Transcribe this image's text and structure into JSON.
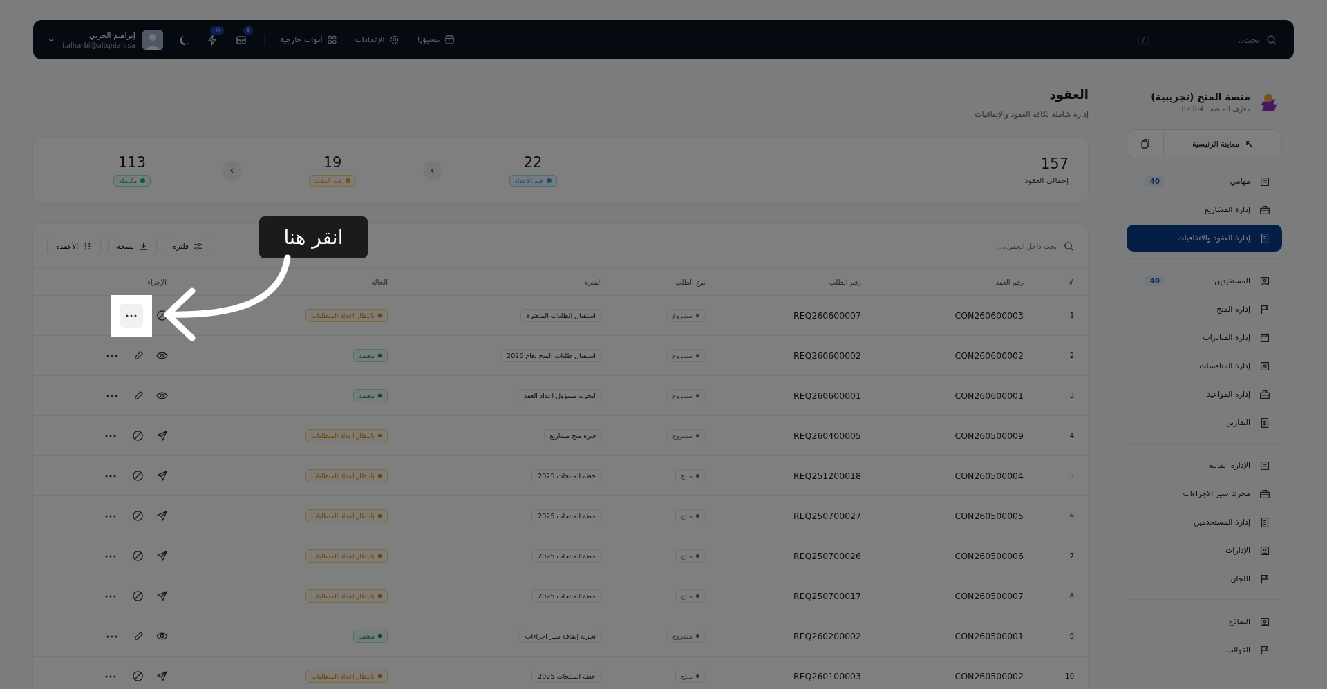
{
  "topbar": {
    "search": {
      "placeholder": "بحث..",
      "shortcut": "/"
    },
    "links": [
      {
        "label": "تنسيق!"
      },
      {
        "label": "الإعدادات"
      },
      {
        "label": "أدوات خارجية"
      }
    ],
    "notifications": [
      {
        "count": "1"
      },
      {
        "count": "39"
      }
    ],
    "user": {
      "name": "إبراهيم الحربي",
      "email": "i.alharbi@altqniah.sa"
    }
  },
  "sidebar": {
    "platform": {
      "name": "منصة المنح (تجريبية)",
      "id_line": "معرّف المنصة : 82384"
    },
    "preview": {
      "label": "معاينة الرئيسية"
    },
    "groups": [
      [
        {
          "label": "مهامي",
          "badge": "40",
          "selected": false
        },
        {
          "label": "إدارة المشاريع",
          "selected": false
        },
        {
          "label": "إدارة العقود والاتفاقيات",
          "selected": true
        }
      ],
      [
        {
          "label": "المستفيدين",
          "badge": "40",
          "selected": false
        },
        {
          "label": "إدارة المنح",
          "selected": false
        },
        {
          "label": "إدارة المبادرات",
          "selected": false
        },
        {
          "label": "إدارة المنافسات",
          "selected": false
        },
        {
          "label": "إدارة المواعيد",
          "selected": false
        },
        {
          "label": "التقارير",
          "selected": false
        }
      ],
      [
        {
          "label": "الإدارة المالية",
          "selected": false
        },
        {
          "label": "محرك سير الاجراءات",
          "selected": false
        },
        {
          "label": "إدارة المستخدمين",
          "selected": false
        },
        {
          "label": "الإدارات",
          "selected": false
        },
        {
          "label": "اللجان",
          "selected": false
        }
      ],
      [
        {
          "label": "النماذج",
          "selected": false
        },
        {
          "label": "القوالب",
          "selected": false
        }
      ]
    ]
  },
  "header": {
    "title": "العقود",
    "subtitle": "إدارة شاملة لكافة العقود والإتفاقيات"
  },
  "stats": {
    "total": {
      "value": "157",
      "label": "إجمالي العقود"
    },
    "items": [
      {
        "value": "22",
        "label": "قيد الاعداد",
        "kind": "preparing"
      },
      {
        "value": "19",
        "label": "قيد التنفيذ",
        "kind": "executing"
      },
      {
        "value": "113",
        "label": "مكتملة",
        "kind": "completed"
      }
    ]
  },
  "table": {
    "search": {
      "placeholder": "بحث داخل الحقول..."
    },
    "tools": [
      {
        "label": "فلترة"
      },
      {
        "label": "نسخة"
      },
      {
        "label": "الأعمدة"
      }
    ],
    "columns": [
      "#",
      "رقم العقد",
      "رقم الطلب",
      "نوع الطلب",
      "الفترة",
      "الحالة",
      "الإجراء"
    ],
    "rows": [
      {
        "index": "1",
        "contract": "CON260600003",
        "request": "REQ260600007",
        "type": "مشروع",
        "period": "استقبال الطلبات المتعثرة",
        "status": {
          "kind": "pending",
          "label": "بانتظار اعداد المتطلبات"
        },
        "highlighted": true
      },
      {
        "index": "2",
        "contract": "CON260600002",
        "request": "REQ260600002",
        "type": "مشروع",
        "period": "استقبال طلبات المنح لعام 2026",
        "status": {
          "kind": "approved",
          "label": "معتمد"
        },
        "highlighted": false
      },
      {
        "index": "3",
        "contract": "CON260600001",
        "request": "REQ260600001",
        "type": "مشروع",
        "period": "لتجربة مسؤول اعداد العقد",
        "status": {
          "kind": "approved",
          "label": "معتمد"
        },
        "highlighted": false
      },
      {
        "index": "4",
        "contract": "CON260500009",
        "request": "REQ260400005",
        "type": "مشروع",
        "period": "فترة منح مشاريع",
        "status": {
          "kind": "pending",
          "label": "بانتظار اعداد المتطلبات"
        },
        "highlighted": false
      },
      {
        "index": "5",
        "contract": "CON260500004",
        "request": "REQ251200018",
        "type": "منتج",
        "period": "خطة المنتجات 2025",
        "status": {
          "kind": "pending",
          "label": "بانتظار اعداد المتطلبات"
        },
        "highlighted": false
      },
      {
        "index": "6",
        "contract": "CON260500005",
        "request": "REQ250700027",
        "type": "منتج",
        "period": "خطة المنتجات 2025",
        "status": {
          "kind": "pending",
          "label": "بانتظار اعداد المتطلبات"
        },
        "highlighted": false
      },
      {
        "index": "7",
        "contract": "CON260500006",
        "request": "REQ250700026",
        "type": "منتج",
        "period": "خطة المنتجات 2025",
        "status": {
          "kind": "pending",
          "label": "بانتظار اعداد المتطلبات"
        },
        "highlighted": false
      },
      {
        "index": "8",
        "contract": "CON260500007",
        "request": "REQ250700017",
        "type": "منتج",
        "period": "خطة المنتجات 2025",
        "status": {
          "kind": "pending",
          "label": "بانتظار اعداد المتطلبات"
        },
        "highlighted": false
      },
      {
        "index": "9",
        "contract": "CON260500001",
        "request": "REQ260200002",
        "type": "مشروع",
        "period": "تجربة إضافة سير اجراءات",
        "status": {
          "kind": "approved",
          "label": "معتمد"
        },
        "highlighted": false
      },
      {
        "index": "10",
        "contract": "CON260500002",
        "request": "REQ260100003",
        "type": "منتج",
        "period": "خطة المنتجات 2025",
        "status": {
          "kind": "pending",
          "label": "بانتظار اعداد المتطلبات"
        },
        "highlighted": false
      }
    ]
  },
  "hint": {
    "text": "انقر هنا"
  }
}
